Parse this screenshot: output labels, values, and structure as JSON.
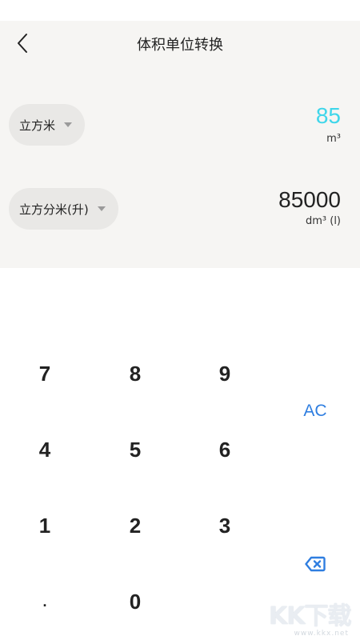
{
  "header": {
    "title": "体积单位转换",
    "back_icon": "chevron-left-icon"
  },
  "converter": {
    "from": {
      "unit_name": "立方米",
      "value": "85",
      "symbol": "m³",
      "value_color": "#3fd6ea"
    },
    "to": {
      "unit_name": "立方分米(升)",
      "value": "85000",
      "symbol": "dm³ (l)",
      "value_color": "#222222"
    }
  },
  "keypad": {
    "k7": "7",
    "k8": "8",
    "k9": "9",
    "k4": "4",
    "k5": "5",
    "k6": "6",
    "k1": "1",
    "k2": "2",
    "k3": "3",
    "dot": ".",
    "k0": "0",
    "ac": "AC",
    "backspace_icon": "backspace-icon",
    "accent_color": "#2f7ee0"
  },
  "watermark": {
    "text": "KK下载",
    "url": "www.kkx.net"
  }
}
